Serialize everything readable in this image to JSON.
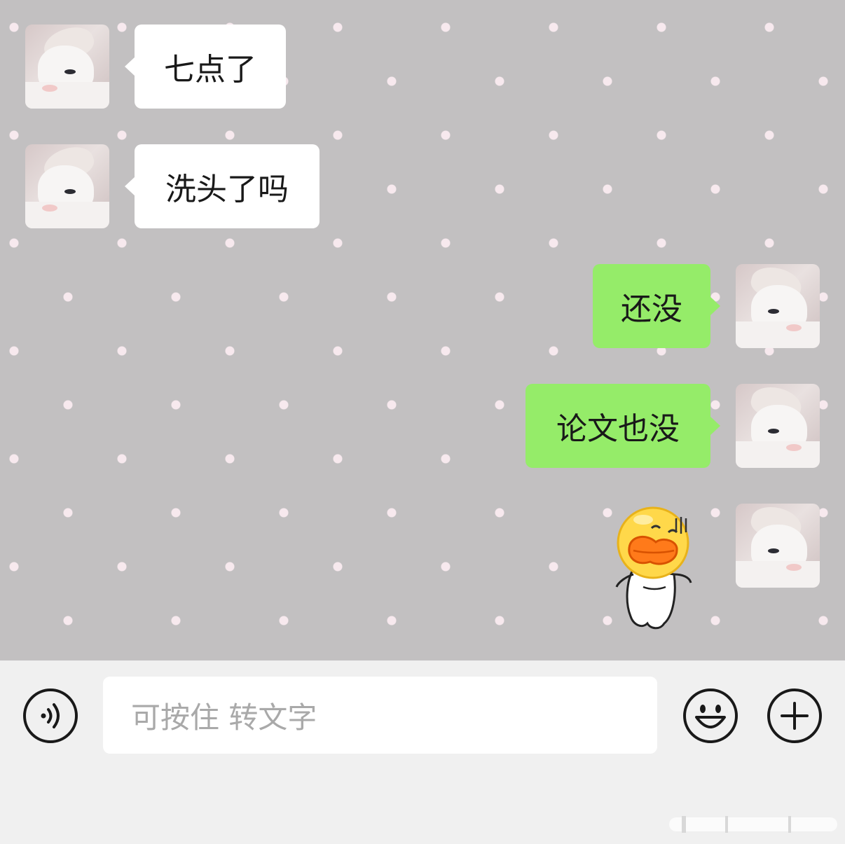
{
  "messages": [
    {
      "side": "received",
      "text": "七点了"
    },
    {
      "side": "received",
      "text": "洗头了吗"
    },
    {
      "side": "sent",
      "text": "还没"
    },
    {
      "side": "sent",
      "text": "论文也没"
    },
    {
      "side": "sent",
      "sticker": "duck-face-sticker"
    }
  ],
  "input": {
    "placeholder": "可按住 转文字"
  },
  "icons": {
    "voice": "voice-wave-icon",
    "emoji": "smiley-icon",
    "more": "plus-icon"
  },
  "colors": {
    "chat_background": "#c2c0c1",
    "polka_dot": "#f7e9ee",
    "received_bubble": "#ffffff",
    "sent_bubble": "#95ec69",
    "input_bar": "#f0f0f0"
  }
}
